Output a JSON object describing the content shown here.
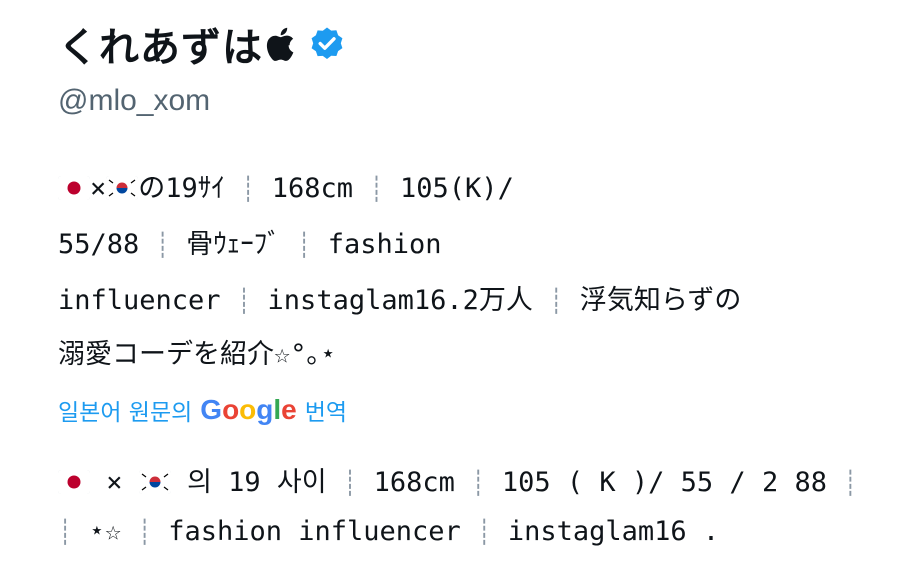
{
  "profile": {
    "display_name": "くれあずは",
    "handle": "@mlo_xom",
    "name_icons": [
      "apple-logo-icon",
      "verified-badge-icon"
    ],
    "verified_color": "#1d9bf0"
  },
  "bio_original": {
    "line1": {
      "flags": [
        "japan-flag-icon",
        "korea-flag-icon"
      ],
      "cross": "×",
      "text1": "の19ｻｲ",
      "text2": "168cm",
      "text3": "105(K)/"
    },
    "line2": {
      "text1": "55/88",
      "text2": "骨ｳｪｰﾌﾞ",
      "text3": "fashion"
    },
    "line3": {
      "text1": "influencer",
      "text2": "instaglam16.2万人",
      "text3": "浮気知らずの"
    },
    "line4": {
      "text1": "溺愛コーデを紹介☆°｡⋆"
    },
    "separator": "┊"
  },
  "translate": {
    "prefix": "일본어 원문의",
    "google": [
      "G",
      "o",
      "o",
      "g",
      "l",
      "e"
    ],
    "suffix": "번역"
  },
  "bio_translated": {
    "line1": {
      "cross": "×",
      "text1": "의 19 사이",
      "text2": "168cm",
      "text3": "105 ( K )/ 55 / 2 88"
    },
    "line2": {
      "text1": "⋆☆",
      "text2": "fashion influencer",
      "text3": "instaglam16 ."
    }
  },
  "colors": {
    "text": "#0f1419",
    "secondary": "#536471",
    "link": "#1d9bf0",
    "separator": "#8b98a5"
  }
}
